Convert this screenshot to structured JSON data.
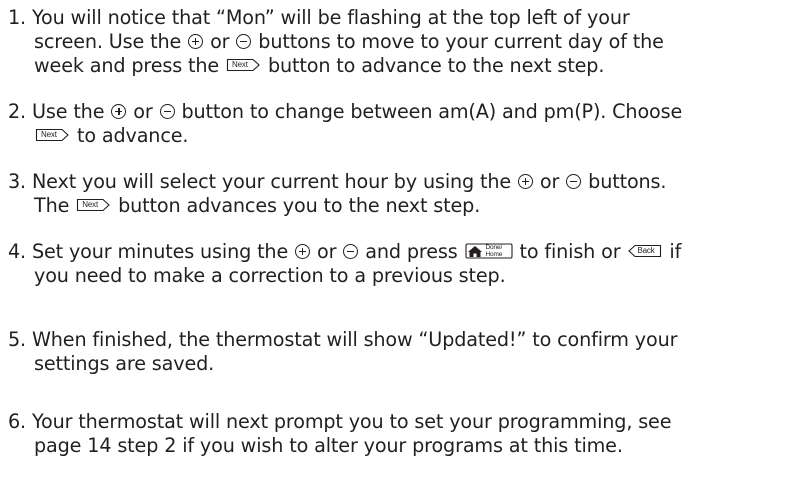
{
  "steps": [
    {
      "num": "1.",
      "l1a": "You will notice that “Mon” will be flashing at the top left of your",
      "l2a": "screen. Use the ",
      "l2b": " or ",
      "l2c": " buttons to move to your current day of the",
      "l3a": "week and press the ",
      "l3b": " button to advance to the next step."
    },
    {
      "num": "2.",
      "l1a": "Use the ",
      "l1b": " or ",
      "l1c": " button to change between am(A) and pm(P). Choose",
      "l2a": " to advance."
    },
    {
      "num": "3.",
      "l1a": "Next you will select your current hour by using the ",
      "l1b": " or ",
      "l1c": " buttons.",
      "l2a": "The ",
      "l2b": " button advances you to the next step."
    },
    {
      "num": "4.",
      "l1a": "Set your minutes using the ",
      "l1b": " or ",
      "l1c": " and press ",
      "l1d": " to finish or ",
      "l1e": " if",
      "l2a": "you need to make a correction to a previous step."
    },
    {
      "num": "5.",
      "l1a": "When finished, the thermostat will show “Updated!” to confirm your",
      "l2a": "settings are saved."
    },
    {
      "num": "6.",
      "l1a": "Your thermostat will next prompt you to set your programming, see",
      "l2a": "page 14 step 2 if you wish to alter your programs at this time."
    }
  ],
  "icons": {
    "next_label": "Next",
    "back_label": "Back",
    "done_label": "Done/",
    "home_label": "Home"
  }
}
